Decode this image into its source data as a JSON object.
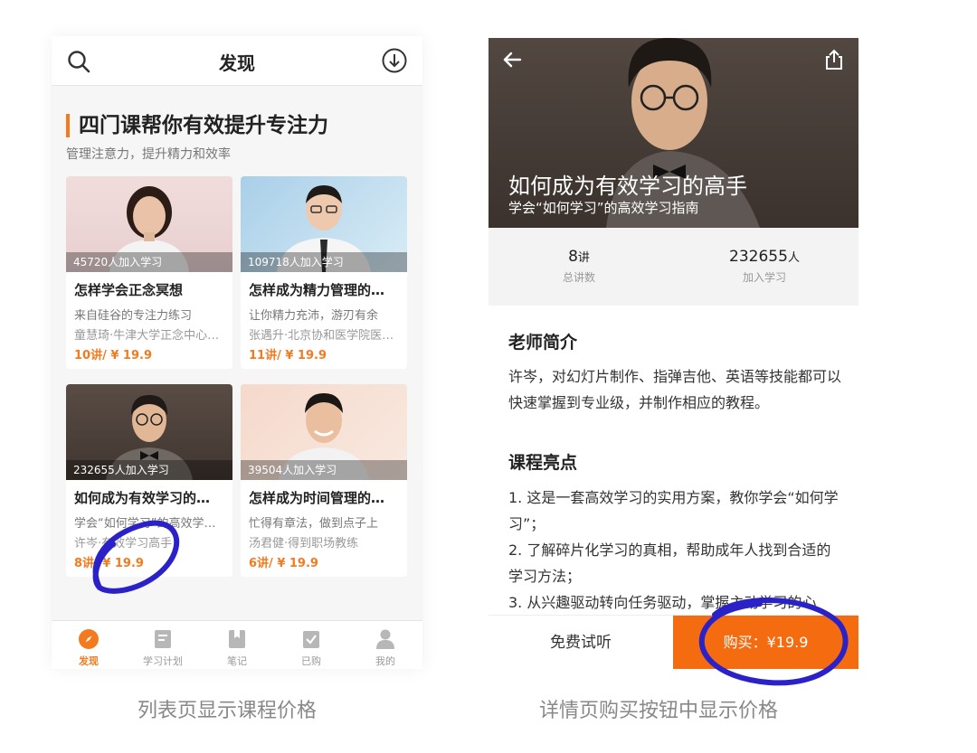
{
  "colors": {
    "accent": "#f47a1f",
    "buy_button": "#f46b10",
    "annotation": "#2a22c8"
  },
  "left": {
    "header": {
      "title": "发现",
      "search_icon": "search-icon",
      "download_icon": "download-icon"
    },
    "section": {
      "title": "四门课帮你有效提升专注力",
      "subtitle": "管理注意力，提升精力和效率"
    },
    "cards": [
      {
        "count": "45720人加入学习",
        "title": "怎样学会正念冥想",
        "subtitle": "来自硅谷的专注力练习",
        "author": "童慧琦·牛津大学正念中心…",
        "price": "10讲/ ¥ 19.9"
      },
      {
        "count": "109718人加入学习",
        "title": "怎样成为精力管理的…",
        "subtitle": "让你精力充沛，游刃有余",
        "author": "张遇升·北京协和医学院医…",
        "price": "11讲/ ¥ 19.9"
      },
      {
        "count": "232655人加入学习",
        "title": "如何成为有效学习的…",
        "subtitle": "学会“如何学习”的高效学…",
        "author": "许岑·有效学习高手",
        "price": "8讲/ ¥ 19.9"
      },
      {
        "count": "39504人加入学习",
        "title": "怎样成为时间管理的…",
        "subtitle": "忙得有章法，做到点子上",
        "author": "汤君健·得到职场教练",
        "price": "6讲/ ¥ 19.9"
      }
    ],
    "tabs": [
      {
        "label": "发现",
        "icon": "compass-icon",
        "active": true
      },
      {
        "label": "学习计划",
        "icon": "document-icon"
      },
      {
        "label": "笔记",
        "icon": "bookmark-icon"
      },
      {
        "label": "已购",
        "icon": "check-clipboard-icon"
      },
      {
        "label": "我的",
        "icon": "person-icon"
      }
    ]
  },
  "right": {
    "hero": {
      "title": "如何成为有效学习的高手",
      "subtitle": "学会“如何学习”的高效学习指南",
      "back_icon": "back-arrow-icon",
      "share_icon": "share-icon"
    },
    "stats": [
      {
        "value": "8",
        "unit": "讲",
        "label": "总讲数"
      },
      {
        "value": "232655",
        "unit": "人",
        "label": "加入学习"
      }
    ],
    "teacher": {
      "heading": "老师简介",
      "text": "许岑，对幻灯片制作、指弹吉他、英语等技能都可以快速掌握到专业级，并制作相应的教程。"
    },
    "highlights": {
      "heading": "课程亮点",
      "items": [
        "1. 这是一套高效学习的实用方案，教你学会“如何学习”；",
        "2. 了解碎片化学习的真相，帮助成年人找到合适的学习方法；",
        "3. 从兴趣驱动转向任务驱动，掌握主动学习的心"
      ]
    },
    "bottom": {
      "trial": "免费试听",
      "buy": "购买：¥19.9"
    }
  },
  "captions": {
    "left": "列表页显示课程价格",
    "right": "详情页购买按钮中显示价格"
  }
}
